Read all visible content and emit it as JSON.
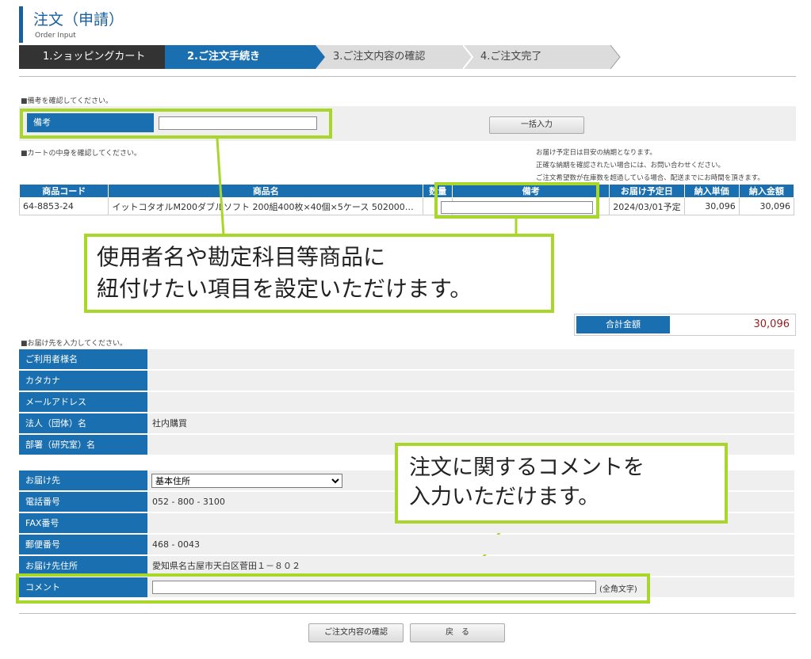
{
  "header": {
    "title": "注文（申請）",
    "subtitle": "Order Input"
  },
  "steps": [
    "1.ショッピングカート",
    "2.ご注文手続き",
    "3.ご注文内容の確認",
    "4.ご注文完了"
  ],
  "remarks_section": {
    "notice": "■備考を確認してください。",
    "label": "備考",
    "value": "",
    "bulk_button": "一括入力"
  },
  "cart_section": {
    "notice": "■カートの中身を確認してください。",
    "info_lines": [
      "お届け予定日は目安の納期となります。",
      "正確な納期を確認されたい場合には、お問い合わせください。",
      "ご注文希望数が在庫数を超過している場合、配送までにお時間を頂きます。"
    ],
    "columns": [
      "商品コード",
      "商品名",
      "数量",
      "備考",
      "お届け予定日",
      "納入単価",
      "納入金額"
    ],
    "rows": [
      {
        "code": "64-8853-24",
        "name": "イットコタオルM200ダブルソフト 200組400枚×40個×5ケース 502000…",
        "qty": "1",
        "remark": "",
        "date": "2024/03/01予定",
        "unit_price": "30,096",
        "amount": "30,096"
      }
    ]
  },
  "callouts": {
    "item_fields": [
      "使用者名や勘定科目等商品に",
      "紐付けたい項目を設定いただけます。"
    ],
    "comment": [
      "注文に関するコメントを",
      "入力いただけます。"
    ]
  },
  "total": {
    "label": "合計金額",
    "value": "30,096"
  },
  "delivery_section": {
    "notice": "■お届け先を入力してください。",
    "rows": [
      {
        "label": "ご利用者様名",
        "value": ""
      },
      {
        "label": "カタカナ",
        "value": ""
      },
      {
        "label": "メールアドレス",
        "value": ""
      },
      {
        "label": "法人（団体）名",
        "value": "社内購買"
      },
      {
        "label": "部署（研究室）名",
        "value": ""
      }
    ],
    "rows2": [
      {
        "label": "お届け先",
        "value": "基本住所"
      },
      {
        "label": "電話番号",
        "value": "052 - 800 - 3100"
      },
      {
        "label": "FAX番号",
        "value": ""
      },
      {
        "label": "郵便番号",
        "value": "468 - 0043"
      },
      {
        "label": "お届け先住所",
        "value": "愛知県名古屋市天白区菅田１－８０２"
      },
      {
        "label": "コメント",
        "value": ""
      }
    ],
    "comment_hint": "(全角文字)"
  },
  "buttons": {
    "confirm": "ご注文内容の確認",
    "back": "戻　る"
  },
  "colors": {
    "accent": "#1a6fb0",
    "highlight": "#a8d62a",
    "total": "#9a1b1b"
  }
}
